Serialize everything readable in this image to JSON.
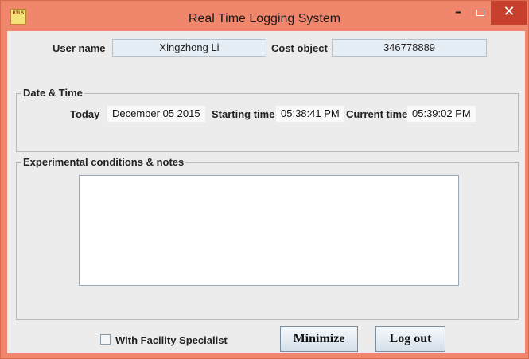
{
  "window": {
    "title": "Real Time Logging System",
    "app_icon_text": "RTLS",
    "controls": {
      "minimize": "–",
      "maximize": "□",
      "close": "✕"
    }
  },
  "header": {
    "user_name_label": "User name",
    "user_name_value": "Xingzhong Li",
    "cost_object_label": "Cost object",
    "cost_object_value": "346778889"
  },
  "date_time": {
    "group_title": "Date & Time",
    "today_label": "Today",
    "today_value": "December 05 2015",
    "starting_label": "Starting time",
    "starting_value": "05:38:41 PM",
    "current_label": "Current time",
    "current_value": "05:39:02 PM"
  },
  "notes": {
    "group_title": "Experimental conditions & notes",
    "value": ""
  },
  "footer": {
    "checkbox_label": "With Facility Specialist",
    "checkbox_checked": false,
    "minimize_label": "Minimize",
    "logout_label": "Log out"
  },
  "colors": {
    "title_bar": "#f0866b",
    "close_button": "#c7402e",
    "field_background": "#e6eef5"
  }
}
